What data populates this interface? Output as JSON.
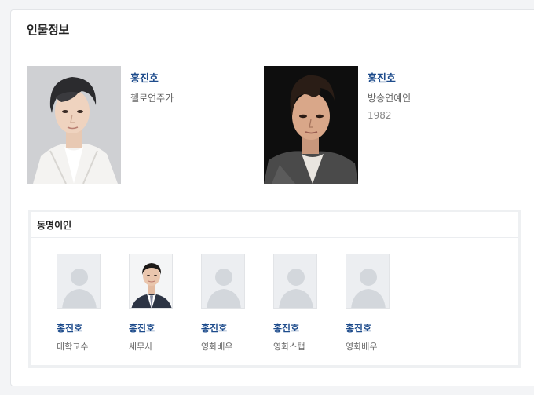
{
  "section": {
    "title": "인물정보"
  },
  "people": [
    {
      "name": "홍진호",
      "job": "첼로연주가",
      "year": ""
    },
    {
      "name": "홍진호",
      "job": "방송연예인",
      "year": "1982"
    }
  ],
  "same_name": {
    "title": "동명이인",
    "items": [
      {
        "name": "홍진호",
        "job": "대학교수",
        "photo": "placeholder"
      },
      {
        "name": "홍진호",
        "job": "세무사",
        "photo": "portrait"
      },
      {
        "name": "홍진호",
        "job": "영화배우",
        "photo": "placeholder"
      },
      {
        "name": "홍진호",
        "job": "영화스탭",
        "photo": "placeholder"
      },
      {
        "name": "홍진호",
        "job": "영화배우",
        "photo": "placeholder"
      }
    ]
  },
  "colors": {
    "link": "#1e4c8c",
    "border": "#e3e5e8"
  }
}
